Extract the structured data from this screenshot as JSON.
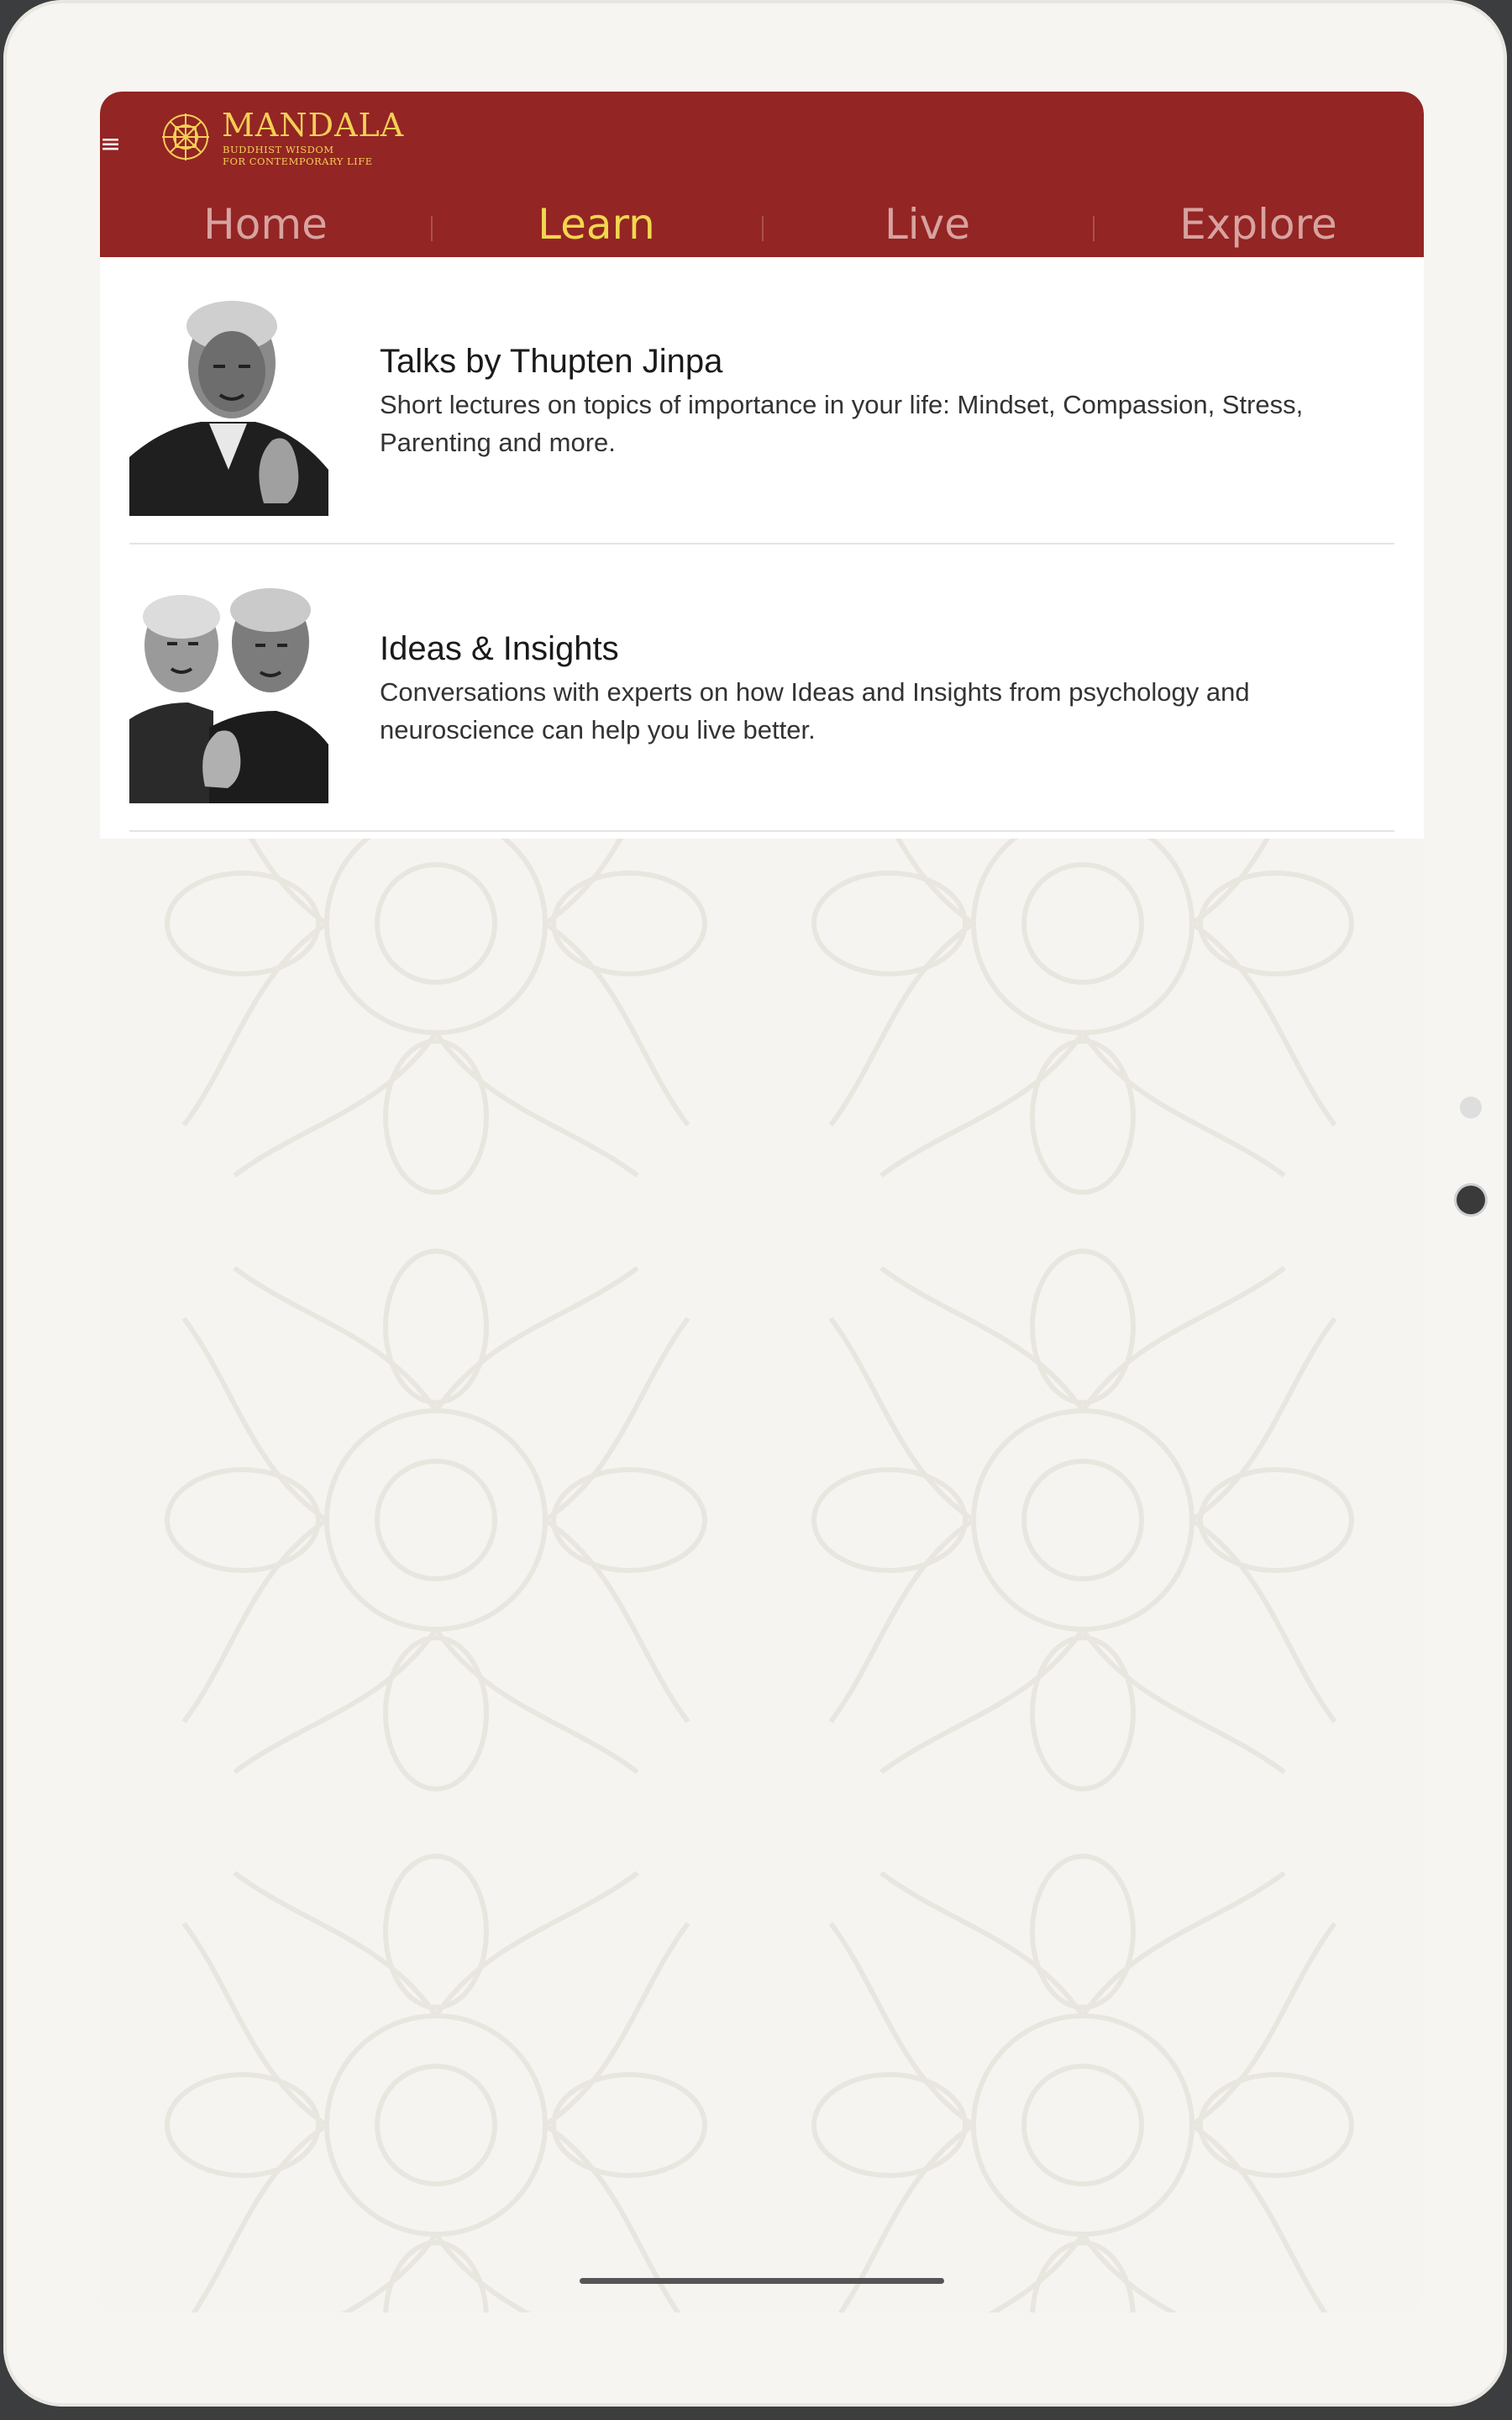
{
  "app": {
    "logo_title": "MANDALA",
    "logo_subtitle_line1": "BUDDHIST WISDOM",
    "logo_subtitle_line2": "FOR CONTEMPORARY LIFE",
    "menu_icon": "hamburger-icon",
    "colors": {
      "header": "#932524",
      "active_tab": "#f2d74e",
      "inactive_tab": "#d7a39f",
      "logo": "#f3cf56"
    }
  },
  "tabs": [
    {
      "label": "Home",
      "active": false
    },
    {
      "label": "Learn",
      "active": true
    },
    {
      "label": "Live",
      "active": false
    },
    {
      "label": "Explore",
      "active": false
    }
  ],
  "items": [
    {
      "title": "Talks by Thupten Jinpa",
      "description": "Short lectures on topics of importance in your life: Mindset, Compassion, Stress, Parenting and more."
    },
    {
      "title": "Ideas & Insights",
      "description": "Conversations with experts on how Ideas and Insights from psychology and neuroscience can help you live better."
    }
  ]
}
